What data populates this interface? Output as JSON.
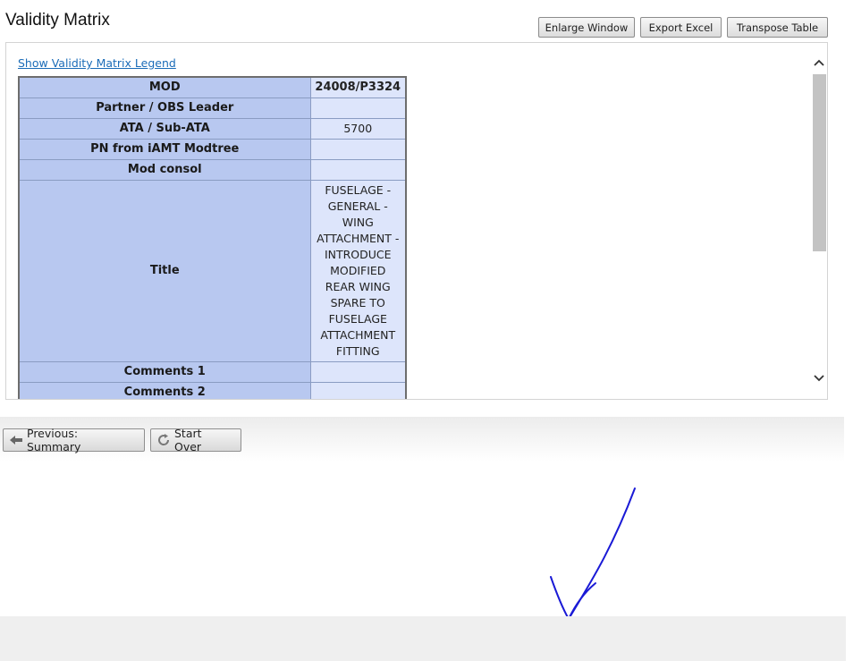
{
  "header": {
    "title": "Validity Matrix",
    "buttons": {
      "enlarge": "Enlarge Window",
      "export": "Export Excel",
      "transpose": "Transpose Table"
    }
  },
  "panel": {
    "legend_link": "Show Validity Matrix Legend",
    "table": {
      "rows": [
        {
          "label": "MOD",
          "value": "24008/P3324"
        },
        {
          "label": "Partner / OBS Leader",
          "value": ""
        },
        {
          "label": "ATA / Sub-ATA",
          "value": "5700"
        },
        {
          "label": "PN from iAMT Modtree",
          "value": ""
        },
        {
          "label": "Mod consol",
          "value": ""
        },
        {
          "label": "Title",
          "value": "FUSELAGE - GENERAL - WING ATTACHMENT - INTRODUCE MODIFIED REAR WING SPARE TO FUSELAGE ATTACHMENT FITTING"
        },
        {
          "label": "Comments 1",
          "value": ""
        },
        {
          "label": "Comments 2",
          "value": ""
        }
      ]
    }
  },
  "navigation": {
    "previous": "Previous: Summary",
    "start_over": "Start Over"
  },
  "icons": {
    "scroll_up": "chevron-up-icon",
    "scroll_down": "chevron-down-icon",
    "previous": "arrow-left-icon",
    "start_over": "refresh-icon"
  },
  "colors": {
    "header_cell": "#b8c8f0",
    "value_cell": "#dde5fb",
    "link": "#1b6cb8",
    "annotation": "#1a1ad6"
  }
}
